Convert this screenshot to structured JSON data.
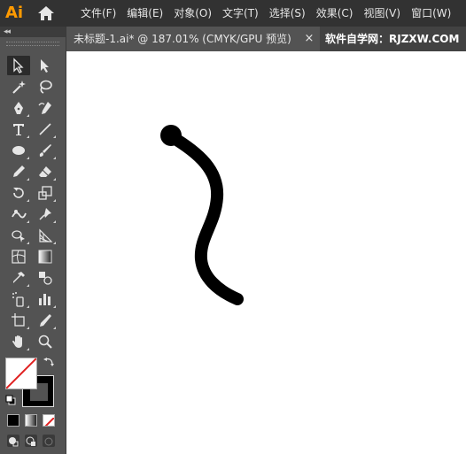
{
  "app": {
    "logo_text": "Ai"
  },
  "menu": [
    "文件(F)",
    "编辑(E)",
    "对象(O)",
    "文字(T)",
    "选择(S)",
    "效果(C)",
    "视图(V)",
    "窗口(W)"
  ],
  "panel": {
    "collapse_label": "◂◂"
  },
  "tools": [
    {
      "name": "selection-tool",
      "icon": "selection-arrow-icon"
    },
    {
      "name": "direct-selection-tool",
      "icon": "direct-selection-icon"
    },
    {
      "name": "magic-wand-tool",
      "icon": "magic-wand-icon"
    },
    {
      "name": "lasso-tool",
      "icon": "lasso-icon"
    },
    {
      "name": "pen-tool",
      "icon": "pen-icon"
    },
    {
      "name": "curvature-tool",
      "icon": "curvature-icon"
    },
    {
      "name": "type-tool",
      "icon": "type-icon"
    },
    {
      "name": "line-segment-tool",
      "icon": "line-icon"
    },
    {
      "name": "ellipse-tool",
      "icon": "ellipse-icon"
    },
    {
      "name": "paintbrush-tool",
      "icon": "brush-icon"
    },
    {
      "name": "pencil-tool",
      "icon": "pencil-icon"
    },
    {
      "name": "eraser-tool",
      "icon": "eraser-icon"
    },
    {
      "name": "rotate-tool",
      "icon": "rotate-icon"
    },
    {
      "name": "scale-tool",
      "icon": "scale-icon"
    },
    {
      "name": "width-tool",
      "icon": "width-icon"
    },
    {
      "name": "puppet-warp-tool",
      "icon": "pin-icon"
    },
    {
      "name": "shape-builder-tool",
      "icon": "shape-builder-icon"
    },
    {
      "name": "perspective-grid-tool",
      "icon": "perspective-icon"
    },
    {
      "name": "mesh-tool",
      "icon": "mesh-icon"
    },
    {
      "name": "gradient-tool",
      "icon": "gradient-icon"
    },
    {
      "name": "eyedropper-tool",
      "icon": "eyedropper-icon"
    },
    {
      "name": "blend-tool",
      "icon": "blend-icon"
    },
    {
      "name": "symbol-sprayer-tool",
      "icon": "spray-icon"
    },
    {
      "name": "column-graph-tool",
      "icon": "bar-graph-icon"
    },
    {
      "name": "artboard-tool",
      "icon": "artboard-icon"
    },
    {
      "name": "slice-tool",
      "icon": "knife-icon"
    },
    {
      "name": "hand-tool",
      "icon": "hand-icon"
    },
    {
      "name": "zoom-tool",
      "icon": "magnifier-icon"
    }
  ],
  "document": {
    "tab_title": "未标题-1.ai* @ 187.01% (CMYK/GPU 预览)",
    "close_glyph": "×"
  },
  "watermark": "软件自学网：RJZXW.COM",
  "colors": {
    "menubar": "#323232",
    "panel": "#535353",
    "canvas": "#ffffff",
    "logo": "#ff9a00",
    "stroke": "#000000",
    "none_slash": "#e02020"
  }
}
